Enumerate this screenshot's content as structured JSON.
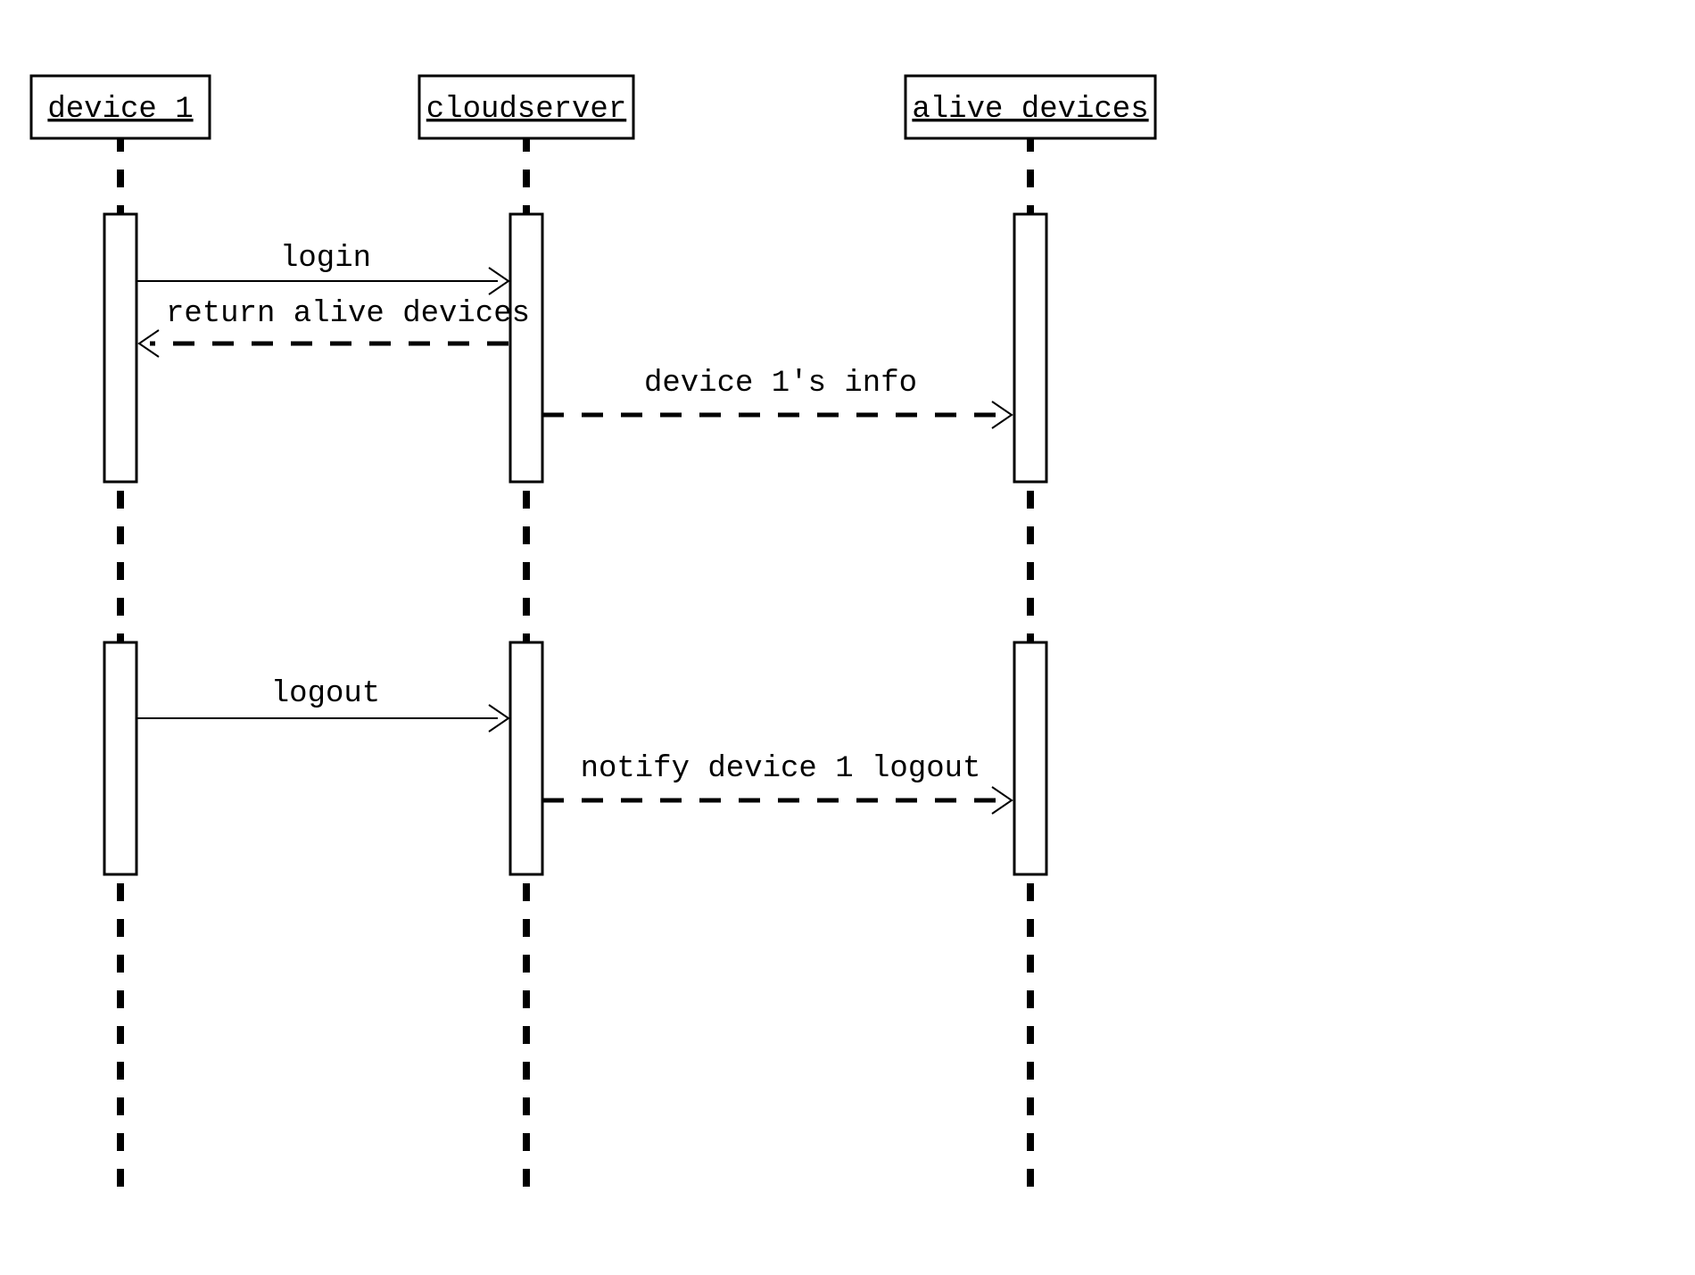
{
  "participants": {
    "p1": "device 1",
    "p2": "cloudserver",
    "p3": "alive devices"
  },
  "messages": {
    "m1": "login",
    "m2": "return alive devices",
    "m3": "device 1's info",
    "m4": "logout",
    "m5": "notify device 1 logout"
  }
}
